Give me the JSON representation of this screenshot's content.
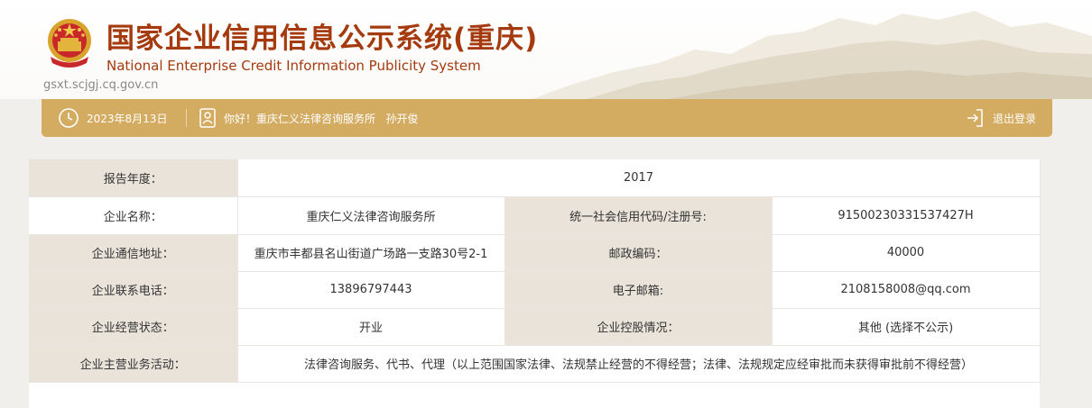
{
  "header": {
    "title_cn": "国家企业信用信息公示系统(重庆)",
    "title_en": "National Enterprise Credit Information Publicity System",
    "site_url": "gsxt.scjgj.cq.gov.cn"
  },
  "topbar": {
    "date": "2023年8月13日",
    "greeting": "你好！重庆仁义法律咨询服务所   孙开俊",
    "logout_label": "退出登录"
  },
  "report": {
    "year_label": "报告年度：",
    "year_value": "2017",
    "rows": [
      {
        "l1": "企业名称：",
        "v1": "重庆仁义法律咨询服务所",
        "l2": "统一社会信用代码/注册号:",
        "v2": "91500230331537427H"
      },
      {
        "l1": "企业通信地址：",
        "v1": "重庆市丰都县名山街道广场路一支路30号2-1",
        "l2": "邮政编码：",
        "v2": "40000"
      },
      {
        "l1": "企业联系电话：",
        "v1": "13896797443",
        "l2": "电子邮箱:",
        "v2": "2108158008@qq.com"
      },
      {
        "l1": "企业经营状态：",
        "v1": "开业",
        "l2": "企业控股情况：",
        "v2": "其他 (选择不公示)"
      }
    ],
    "business_label": "企业主营业务活动：",
    "business_value": "法律咨询服务、代书、代理（以上范围国家法律、法规禁止经营的不得经营；法律、法规规定应经审批而未获得审批前不得经营）"
  },
  "icons": {
    "emblem": "national-emblem-icon",
    "calendar": "clock-icon",
    "user": "user-card-icon",
    "logout": "logout-icon"
  },
  "colors": {
    "brand": "#a53a0f",
    "bar": "#d3ac62",
    "label_bg": "#e9e3da"
  }
}
